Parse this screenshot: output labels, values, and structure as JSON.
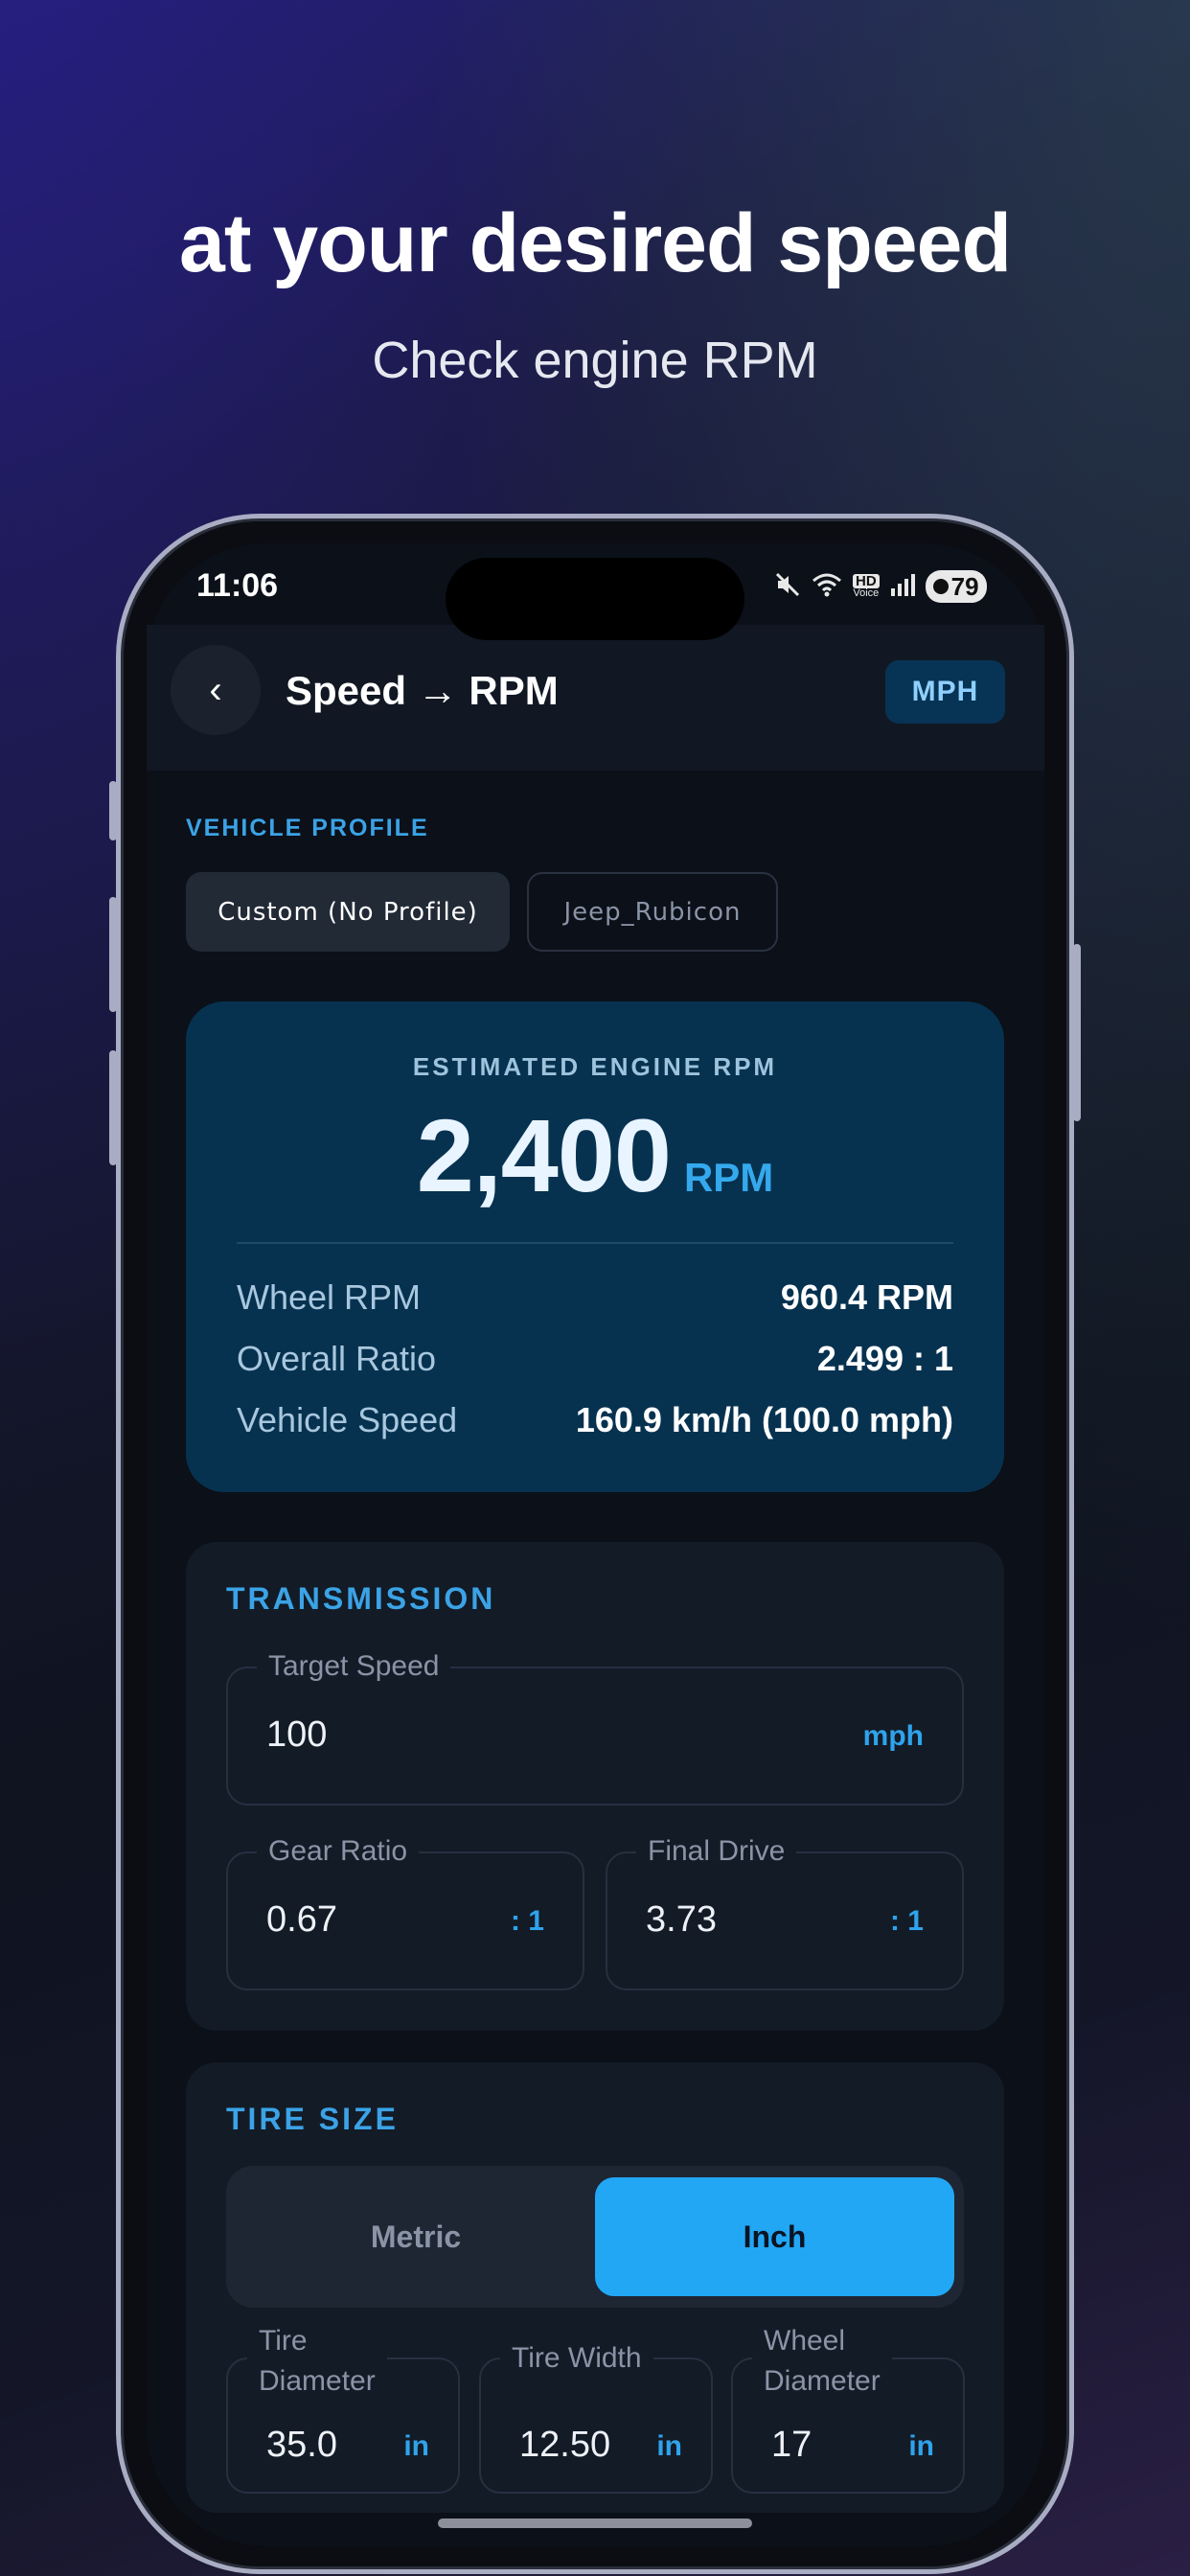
{
  "promo": {
    "headline": "at your desired speed",
    "subline": "Check engine RPM"
  },
  "status_bar": {
    "time": "11:06",
    "battery": "79",
    "icons": [
      "mute-icon",
      "wifi-icon",
      "hd-voice-icon",
      "signal-icon",
      "battery-icon"
    ],
    "hd_label": "HD",
    "voice_label": "Voice"
  },
  "header": {
    "back_label": "‹",
    "title": "Speed → RPM",
    "unit_toggle": "MPH"
  },
  "vehicle_profile": {
    "label": "VEHICLE PROFILE",
    "chips": [
      "Custom (No Profile)",
      "Jeep_Rubicon"
    ],
    "selected": "Custom (No Profile)"
  },
  "result": {
    "label": "ESTIMATED ENGINE RPM",
    "value": "2,400",
    "unit": "RPM",
    "rows": [
      {
        "key": "Wheel RPM",
        "value": "960.4 RPM"
      },
      {
        "key": "Overall Ratio",
        "value": "2.499 : 1"
      },
      {
        "key": "Vehicle Speed",
        "value": "160.9 km/h (100.0 mph)"
      }
    ]
  },
  "transmission": {
    "title": "TRANSMISSION",
    "target_speed": {
      "label": "Target Speed",
      "value": "100",
      "suffix": "mph"
    },
    "gear_ratio": {
      "label": "Gear Ratio",
      "value": "0.67",
      "suffix": ": 1"
    },
    "final_drive": {
      "label": "Final Drive",
      "value": "3.73",
      "suffix": ": 1"
    }
  },
  "tire_size": {
    "title": "TIRE SIZE",
    "modes": [
      "Metric",
      "Inch"
    ],
    "selected_mode": "Inch",
    "tire_diameter": {
      "label_line1": "Tire",
      "label_line2": "Diameter",
      "value": "35.0",
      "suffix": "in"
    },
    "tire_width": {
      "label": "Tire Width",
      "value": "12.50",
      "suffix": "in"
    },
    "wheel_diameter": {
      "label_line1": "Wheel",
      "label_line2": "Diameter",
      "value": "17",
      "suffix": "in"
    }
  },
  "colors": {
    "accent": "#22a7f5",
    "result_card": "#063250",
    "screen_bg": "#0b1019"
  }
}
